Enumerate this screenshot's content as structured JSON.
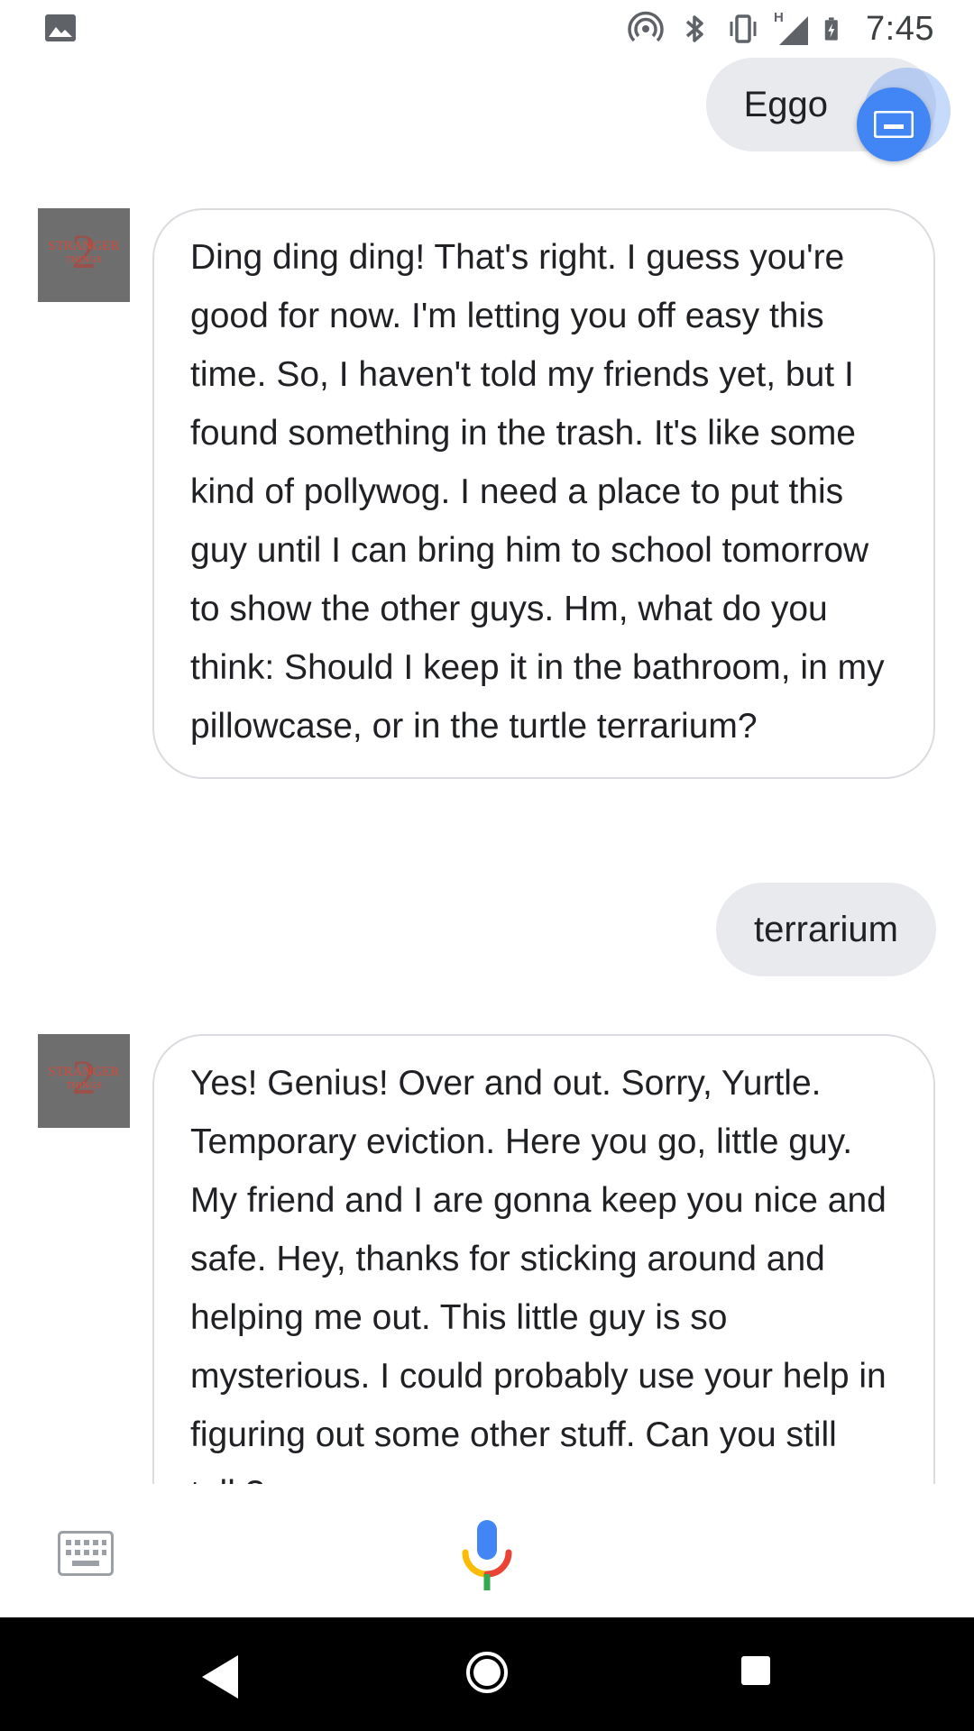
{
  "status_bar": {
    "time": "7:45",
    "network_label": "H"
  },
  "messages": [
    {
      "role": "user",
      "text": "Eggo"
    },
    {
      "role": "bot",
      "text": "Ding ding ding! That's right. I guess you're good for now. I'm letting you off easy this time. So, I haven't told my friends yet, but I found something in the trash. It's like some kind of pollywog. I need a place to put this guy until I can bring him to school tomorrow to show the other guys. Hm, what do you think: Should I keep it in the bathroom, in my pillowcase, or in the turtle terrarium?"
    },
    {
      "role": "user",
      "text": "terrarium"
    },
    {
      "role": "bot",
      "text": "Yes! Genius! Over and out. Sorry, Yurtle. Temporary eviction. Here you go, little guy. My friend and I are gonna keep you nice and safe. Hey, thanks for sticking around and helping me out. This little guy is so mysterious. I could probably use your help in figuring out some other stuff. Can you still talk?"
    }
  ],
  "avatar": {
    "logo_text": "STRANGER THINGS",
    "logo_number": "2"
  },
  "colors": {
    "accent_blue": "#4285f4",
    "user_bubble_bg": "#e8eaed",
    "bot_bubble_border": "#dadce0",
    "nav_bar_bg": "#000000"
  },
  "icons": {
    "status_left": "image-icon",
    "hotspot": "hotspot-icon",
    "bluetooth": "bluetooth-icon",
    "vibrate": "vibrate-icon",
    "signal": "signal-icon",
    "battery": "battery-charging-icon",
    "floating_button": "keyboard-icon",
    "input_keyboard": "keyboard-icon",
    "input_mic": "microphone-icon",
    "nav_back": "back-icon",
    "nav_home": "home-icon",
    "nav_recents": "recents-icon"
  }
}
